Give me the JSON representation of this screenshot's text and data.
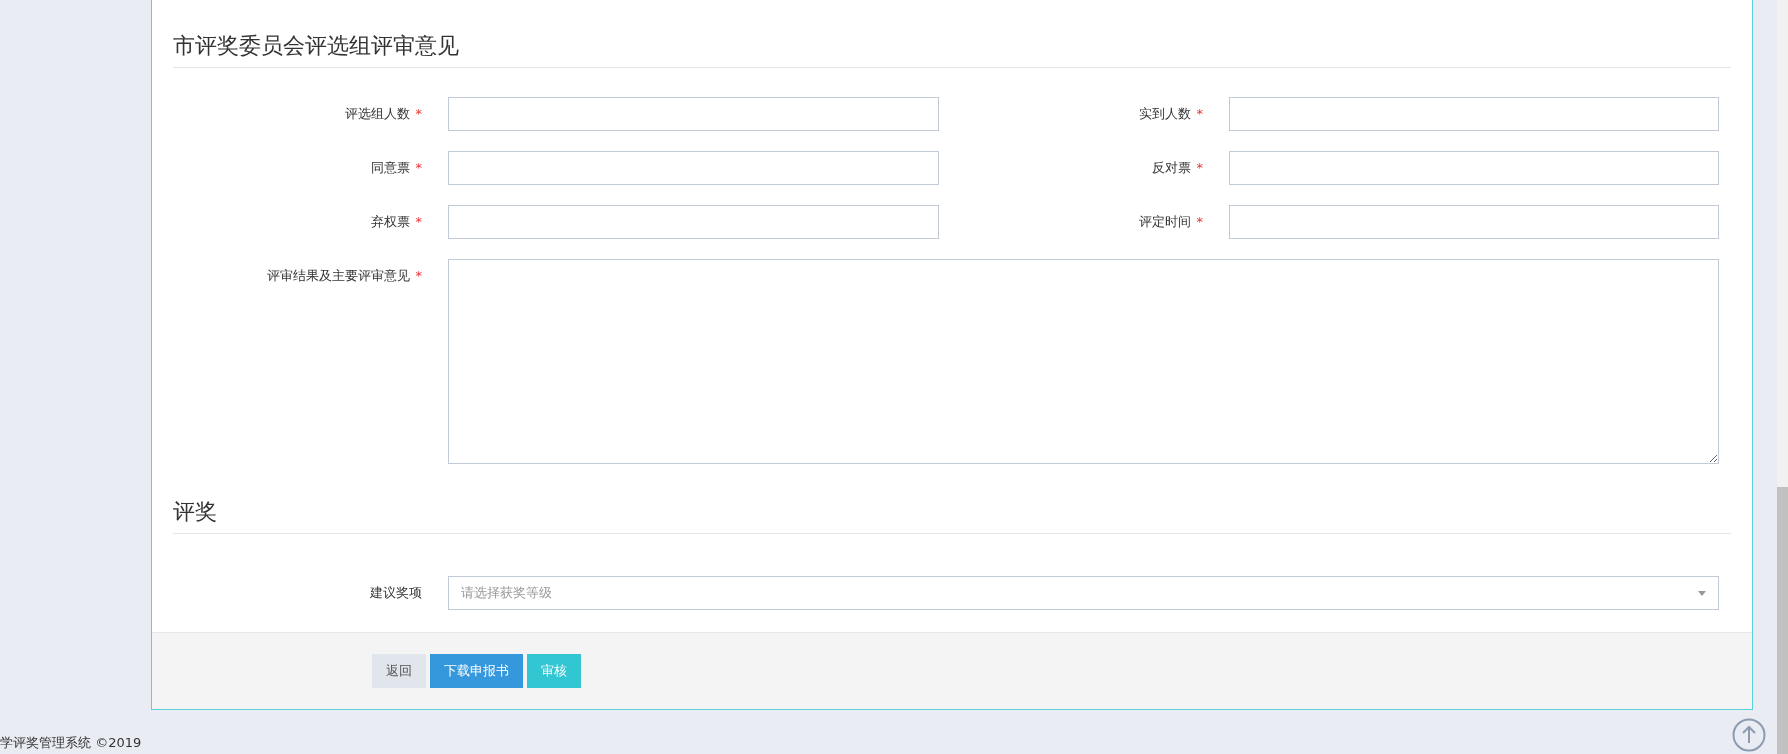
{
  "sections": [
    {
      "title": "市评奖委员会评选组评审意见",
      "fields": [
        {
          "kind": "text",
          "label": "评选组人数",
          "required_mark": "*"
        },
        {
          "kind": "text",
          "label": "实到人数",
          "required_mark": "*"
        },
        {
          "kind": "text",
          "label": "同意票",
          "required_mark": "*"
        },
        {
          "kind": "text",
          "label": "反对票",
          "required_mark": "*"
        },
        {
          "kind": "text",
          "label": "弃权票",
          "required_mark": "*"
        },
        {
          "kind": "text",
          "label": "评定时间",
          "required_mark": "*"
        },
        {
          "kind": "textarea",
          "label": "评审结果及主要评审意见",
          "required_mark": "*"
        }
      ]
    },
    {
      "title": "评奖",
      "fields": [
        {
          "kind": "select",
          "label": "建议奖项",
          "placeholder": "请选择获奖等级"
        }
      ]
    }
  ],
  "buttons": [
    {
      "label": "返回",
      "kind": "default"
    },
    {
      "label": "下载申报书",
      "kind": "primary"
    },
    {
      "label": "审核",
      "kind": "info"
    }
  ],
  "footer": "学评奖管理系统 ©2019"
}
